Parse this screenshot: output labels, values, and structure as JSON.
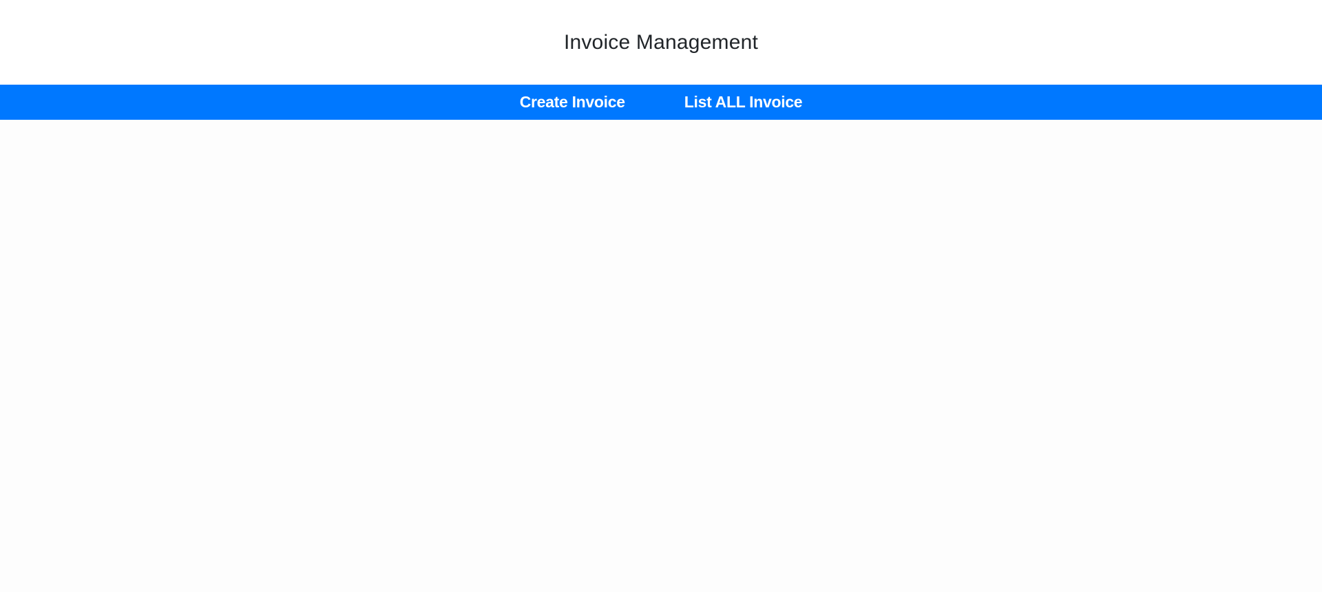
{
  "header": {
    "title": "Invoice Management"
  },
  "nav": {
    "items": [
      {
        "label": "Create Invoice"
      },
      {
        "label": "List ALL Invoice"
      }
    ]
  },
  "colors": {
    "navbar": "#0078ff",
    "nav_text": "#ffffff",
    "title_text": "#212529",
    "background": "#fdfdfd"
  }
}
